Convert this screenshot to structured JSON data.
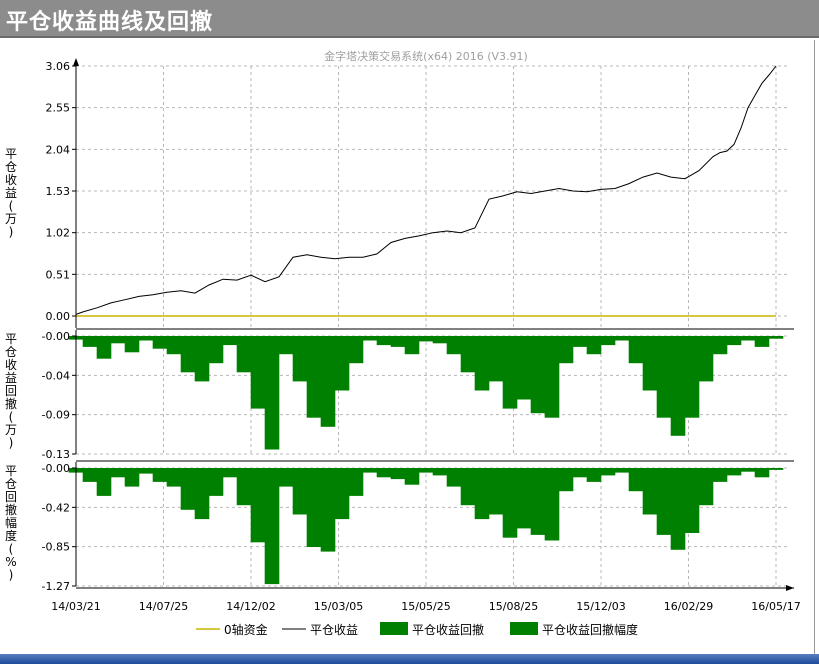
{
  "window": {
    "title": "平仓收益曲线及回撤"
  },
  "chart_data": {
    "type": "line",
    "watermark": "金字塔决策交易系统(x64) 2016 (V3.91)",
    "x_ticks": [
      "14/03/21",
      "14/07/25",
      "14/12/02",
      "15/03/05",
      "15/05/25",
      "15/08/25",
      "15/12/03",
      "16/02/29",
      "16/05/17"
    ],
    "legend": [
      "0轴资金",
      "平仓收益",
      "平仓收益回撤",
      "平仓收益回撤幅度"
    ],
    "legend_placement": "bottom",
    "colors": {
      "zero": "#c8b400",
      "equity": "#000000",
      "drawdown": "#008000"
    },
    "grid": true,
    "panels": [
      {
        "ylabel": "平仓收益(万)",
        "yticks": [
          "3.06",
          "2.55",
          "2.04",
          "1.53",
          "1.02",
          "0.51",
          "0.00"
        ],
        "ylim": [
          0,
          3.06
        ],
        "series": [
          {
            "name": "0轴资金",
            "values": [
              0,
              0
            ]
          },
          {
            "name": "平仓收益",
            "x": [
              0,
              0.01,
              0.03,
              0.05,
              0.07,
              0.09,
              0.11,
              0.13,
              0.15,
              0.17,
              0.19,
              0.21,
              0.23,
              0.25,
              0.27,
              0.29,
              0.31,
              0.33,
              0.35,
              0.37,
              0.39,
              0.41,
              0.43,
              0.45,
              0.47,
              0.49,
              0.51,
              0.53,
              0.55,
              0.57,
              0.59,
              0.61,
              0.63,
              0.65,
              0.67,
              0.69,
              0.71,
              0.73,
              0.75,
              0.77,
              0.79,
              0.81,
              0.83,
              0.85,
              0.87,
              0.89,
              0.91,
              0.92,
              0.93,
              0.94,
              0.95,
              0.96,
              0.97,
              0.98,
              0.99,
              1.0
            ],
            "values": [
              0.02,
              0.05,
              0.1,
              0.16,
              0.2,
              0.24,
              0.26,
              0.29,
              0.31,
              0.28,
              0.38,
              0.45,
              0.44,
              0.5,
              0.42,
              0.48,
              0.72,
              0.75,
              0.72,
              0.7,
              0.72,
              0.72,
              0.76,
              0.9,
              0.95,
              0.98,
              1.02,
              1.04,
              1.02,
              1.08,
              1.43,
              1.47,
              1.52,
              1.5,
              1.53,
              1.56,
              1.53,
              1.52,
              1.55,
              1.56,
              1.62,
              1.7,
              1.75,
              1.7,
              1.68,
              1.78,
              1.95,
              2.0,
              2.02,
              2.1,
              2.3,
              2.55,
              2.7,
              2.85,
              2.95,
              3.06
            ]
          }
        ]
      },
      {
        "ylabel": "平仓收益回撤(万)",
        "yticks": [
          "-0.00",
          "-0.04",
          "-0.09",
          "-0.13"
        ],
        "ylim": [
          -0.13,
          0
        ],
        "series": [
          {
            "name": "平仓收益回撤",
            "x": [
              0,
              0.02,
              0.04,
              0.06,
              0.08,
              0.1,
              0.12,
              0.14,
              0.16,
              0.18,
              0.2,
              0.22,
              0.24,
              0.26,
              0.28,
              0.3,
              0.32,
              0.34,
              0.36,
              0.38,
              0.4,
              0.42,
              0.44,
              0.46,
              0.48,
              0.5,
              0.52,
              0.54,
              0.56,
              0.58,
              0.6,
              0.62,
              0.64,
              0.66,
              0.68,
              0.7,
              0.72,
              0.74,
              0.76,
              0.78,
              0.8,
              0.82,
              0.84,
              0.86,
              0.88,
              0.9,
              0.92,
              0.94,
              0.96,
              0.98,
              1.0
            ],
            "values": [
              -0.004,
              -0.012,
              -0.025,
              -0.008,
              -0.018,
              -0.005,
              -0.014,
              -0.02,
              -0.04,
              -0.05,
              -0.03,
              -0.01,
              -0.04,
              -0.08,
              -0.125,
              -0.02,
              -0.05,
              -0.09,
              -0.1,
              -0.06,
              -0.03,
              -0.005,
              -0.01,
              -0.012,
              -0.02,
              -0.006,
              -0.008,
              -0.02,
              -0.04,
              -0.06,
              -0.05,
              -0.08,
              -0.07,
              -0.085,
              -0.09,
              -0.03,
              -0.012,
              -0.02,
              -0.01,
              -0.005,
              -0.03,
              -0.06,
              -0.09,
              -0.11,
              -0.09,
              -0.05,
              -0.02,
              -0.01,
              -0.005,
              -0.012,
              -0.003
            ]
          }
        ]
      },
      {
        "ylabel": "平仓回撤幅度(%)",
        "yticks": [
          "-0.00",
          "-0.42",
          "-0.85",
          "-1.27"
        ],
        "ylim": [
          -1.27,
          0
        ],
        "series": [
          {
            "name": "平仓收益回撤幅度",
            "x": [
              0,
              0.02,
              0.04,
              0.06,
              0.08,
              0.1,
              0.12,
              0.14,
              0.16,
              0.18,
              0.2,
              0.22,
              0.24,
              0.26,
              0.28,
              0.3,
              0.32,
              0.34,
              0.36,
              0.38,
              0.4,
              0.42,
              0.44,
              0.46,
              0.48,
              0.5,
              0.52,
              0.54,
              0.56,
              0.58,
              0.6,
              0.62,
              0.64,
              0.66,
              0.68,
              0.7,
              0.72,
              0.74,
              0.76,
              0.78,
              0.8,
              0.82,
              0.84,
              0.86,
              0.88,
              0.9,
              0.92,
              0.94,
              0.96,
              0.98,
              1.0
            ],
            "values": [
              -0.05,
              -0.15,
              -0.3,
              -0.1,
              -0.2,
              -0.06,
              -0.15,
              -0.2,
              -0.45,
              -0.55,
              -0.3,
              -0.1,
              -0.4,
              -0.8,
              -1.25,
              -0.2,
              -0.5,
              -0.85,
              -0.9,
              -0.55,
              -0.3,
              -0.05,
              -0.1,
              -0.12,
              -0.18,
              -0.05,
              -0.08,
              -0.2,
              -0.4,
              -0.55,
              -0.5,
              -0.75,
              -0.65,
              -0.72,
              -0.78,
              -0.25,
              -0.1,
              -0.15,
              -0.08,
              -0.05,
              -0.25,
              -0.5,
              -0.72,
              -0.88,
              -0.7,
              -0.4,
              -0.15,
              -0.08,
              -0.04,
              -0.1,
              -0.02
            ]
          }
        ]
      }
    ]
  }
}
